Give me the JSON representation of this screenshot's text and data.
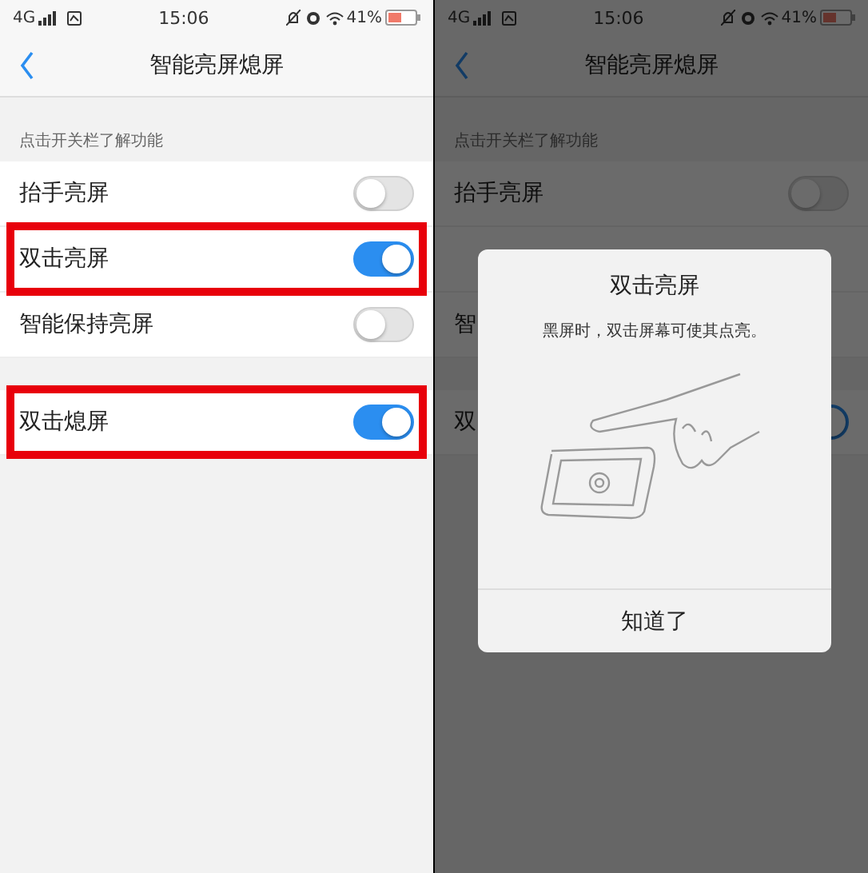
{
  "screens": [
    {
      "dimmed": false,
      "status_bar": {
        "network": "4G",
        "time": "15:06",
        "battery": "41%"
      },
      "header": {
        "title": "智能亮屏熄屏"
      },
      "section_label": "点击开关栏了解功能",
      "groups": [
        [
          {
            "kind": "toggle",
            "label": "抬手亮屏",
            "on": false,
            "highlighted": false
          },
          {
            "kind": "toggle",
            "label": "双击亮屏",
            "on": true,
            "highlighted": true
          },
          {
            "kind": "toggle",
            "label": "智能保持亮屏",
            "on": false,
            "highlighted": false
          }
        ],
        [
          {
            "kind": "toggle",
            "label": "双击熄屏",
            "on": true,
            "highlighted": true
          }
        ]
      ]
    },
    {
      "dimmed": true,
      "status_bar": {
        "network": "4G",
        "time": "15:06",
        "battery": "41%"
      },
      "header": {
        "title": "智能亮屏熄屏"
      },
      "section_label": "点击开关栏了解功能",
      "groups": [
        [
          {
            "kind": "toggle",
            "label": "抬手亮屏",
            "on": false,
            "highlighted": false
          },
          {
            "kind": "covered"
          },
          {
            "kind": "label",
            "label": "智",
            "highlighted": false
          }
        ],
        [
          {
            "kind": "toggle",
            "label": "双",
            "on": true,
            "highlighted": false
          }
        ]
      ],
      "dialog": {
        "title": "双击亮屏",
        "message": "黑屏时，双击屏幕可使其点亮。",
        "button": "知道了"
      }
    }
  ]
}
